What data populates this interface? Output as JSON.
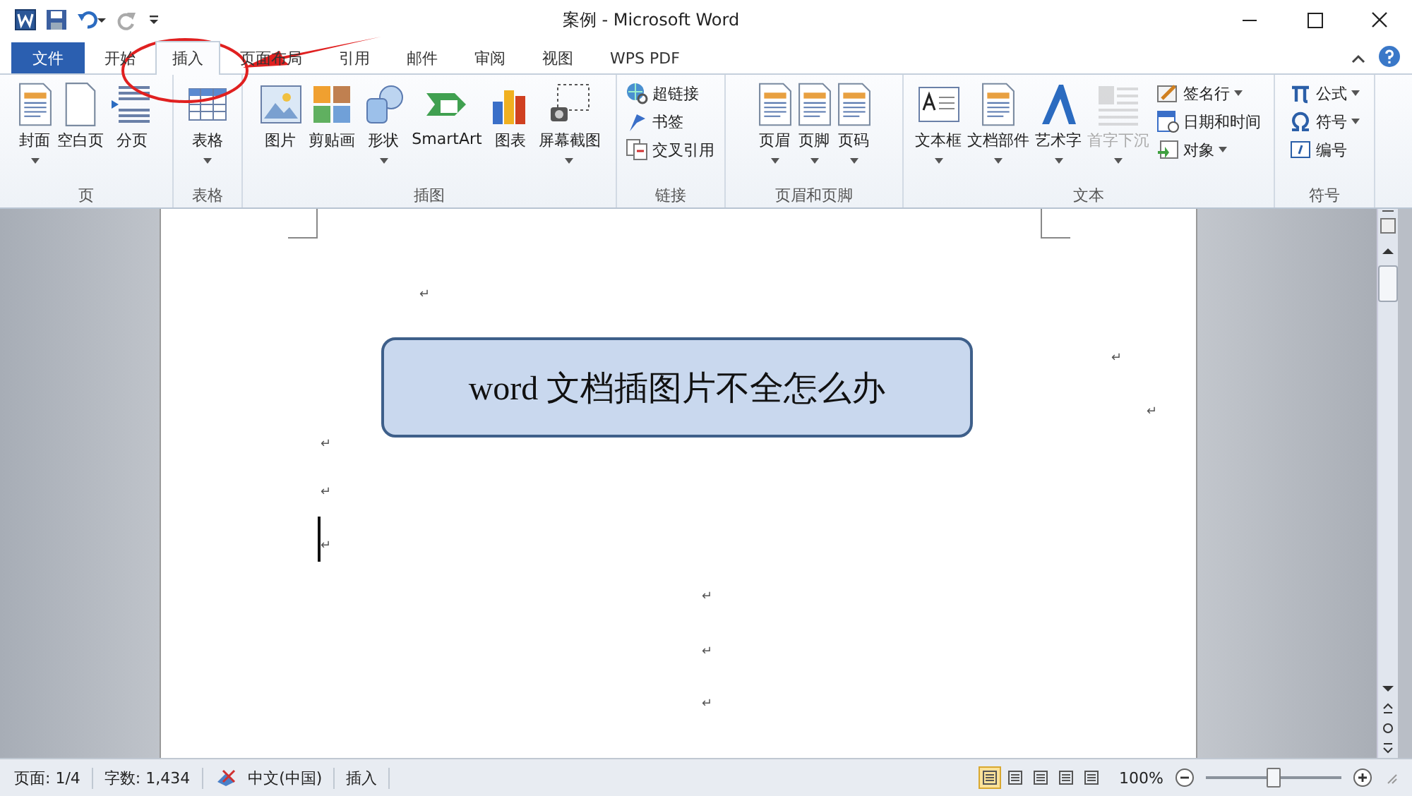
{
  "window": {
    "title": "案例 - Microsoft Word"
  },
  "tabs": [
    {
      "label": "文件",
      "kind": "file",
      "selected": false
    },
    {
      "label": "开始",
      "kind": "normal",
      "selected": false
    },
    {
      "label": "插入",
      "kind": "normal",
      "selected": true
    },
    {
      "label": "页面布局",
      "kind": "normal",
      "selected": false
    },
    {
      "label": "引用",
      "kind": "normal",
      "selected": false
    },
    {
      "label": "邮件",
      "kind": "normal",
      "selected": false
    },
    {
      "label": "审阅",
      "kind": "normal",
      "selected": false
    },
    {
      "label": "视图",
      "kind": "normal",
      "selected": false
    },
    {
      "label": "WPS PDF",
      "kind": "normal",
      "selected": false
    }
  ],
  "ribbon": [
    {
      "label": "页",
      "items": [
        {
          "label": "封面",
          "kind": "large",
          "dropdown": true,
          "disabled": false
        },
        {
          "label": "空白页",
          "kind": "large",
          "dropdown": false,
          "disabled": false
        },
        {
          "label": "分页",
          "kind": "large",
          "dropdown": false,
          "disabled": false
        }
      ]
    },
    {
      "label": "表格",
      "items": [
        {
          "label": "表格",
          "kind": "large",
          "dropdown": true,
          "disabled": false
        }
      ]
    },
    {
      "label": "插图",
      "items": [
        {
          "label": "图片",
          "kind": "large",
          "dropdown": false,
          "disabled": false
        },
        {
          "label": "剪贴画",
          "kind": "large",
          "dropdown": false,
          "disabled": false
        },
        {
          "label": "形状",
          "kind": "large",
          "dropdown": true,
          "disabled": false
        },
        {
          "label": "SmartArt",
          "kind": "large",
          "dropdown": false,
          "disabled": false
        },
        {
          "label": "图表",
          "kind": "large",
          "dropdown": false,
          "disabled": false
        },
        {
          "label": "屏幕截图",
          "kind": "large",
          "dropdown": true,
          "disabled": false
        }
      ]
    },
    {
      "label": "链接",
      "items": [
        {
          "label": "超链接",
          "kind": "small",
          "dropdown": false,
          "disabled": false
        },
        {
          "label": "书签",
          "kind": "small",
          "dropdown": false,
          "disabled": false
        },
        {
          "label": "交叉引用",
          "kind": "small",
          "dropdown": false,
          "disabled": false
        }
      ]
    },
    {
      "label": "页眉和页脚",
      "items": [
        {
          "label": "页眉",
          "kind": "large",
          "dropdown": true,
          "disabled": false
        },
        {
          "label": "页脚",
          "kind": "large",
          "dropdown": true,
          "disabled": false
        },
        {
          "label": "页码",
          "kind": "large",
          "dropdown": true,
          "disabled": false
        }
      ]
    },
    {
      "label": "文本",
      "items": [
        {
          "label": "文本框",
          "kind": "large",
          "dropdown": true,
          "disabled": false
        },
        {
          "label": "文档部件",
          "kind": "large",
          "dropdown": true,
          "disabled": false
        },
        {
          "label": "艺术字",
          "kind": "large",
          "dropdown": true,
          "disabled": false
        },
        {
          "label": "首字下沉",
          "kind": "large",
          "dropdown": true,
          "disabled": true
        },
        {
          "label": "签名行",
          "kind": "small",
          "dropdown": true,
          "disabled": false
        },
        {
          "label": "日期和时间",
          "kind": "small",
          "dropdown": false,
          "disabled": false
        },
        {
          "label": "对象",
          "kind": "small",
          "dropdown": true,
          "disabled": false
        }
      ]
    },
    {
      "label": "符号",
      "items": [
        {
          "label": "公式",
          "kind": "small",
          "dropdown": true,
          "disabled": false
        },
        {
          "label": "符号",
          "kind": "small",
          "dropdown": true,
          "disabled": false
        },
        {
          "label": "编号",
          "kind": "small",
          "dropdown": false,
          "disabled": false
        }
      ]
    }
  ],
  "document": {
    "heading": "word 文档插图片不全怎么办",
    "marks": [
      "↵",
      "↵",
      "↵",
      "↵",
      "↵",
      "↵",
      "↵",
      "↵",
      "↵"
    ]
  },
  "status_bar": {
    "items": [
      "页面: 1/4",
      "字数: 1,434",
      "中文(中国)",
      "插入"
    ],
    "views": [
      {
        "selected": true
      },
      {
        "selected": false
      },
      {
        "selected": false
      },
      {
        "selected": false
      },
      {
        "selected": false
      }
    ],
    "zoom": "100%",
    "zoom_slider": {
      "level": 0.5
    }
  }
}
